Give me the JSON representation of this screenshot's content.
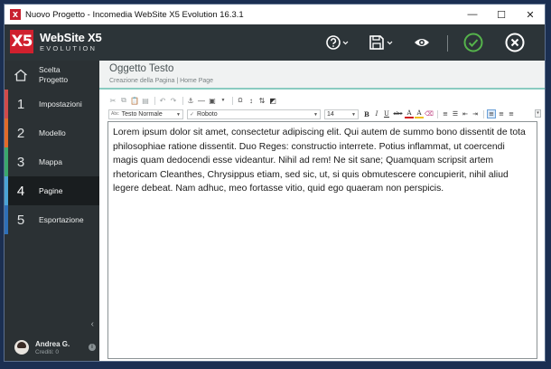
{
  "window": {
    "title": "Nuovo Progetto - Incomedia WebSite X5 Evolution 16.3.1",
    "controls": {
      "minimize": "—",
      "maximize": "☐",
      "close": "✕"
    }
  },
  "header": {
    "logo_main": "WebSite X5",
    "logo_sub": "EVOLUTION",
    "logo_mark": "X5",
    "actions": [
      "help-icon",
      "save-icon",
      "preview-icon",
      "confirm-icon",
      "close-icon"
    ],
    "colors": {
      "bar": "#2c3438",
      "accent": "#d0202e",
      "confirm": "#55b34b"
    }
  },
  "sidebar": {
    "home_label_1": "Scelta",
    "home_label_2": "Progetto",
    "items": [
      {
        "num": "1",
        "label": "Impostazioni",
        "color": "#d04a4a"
      },
      {
        "num": "2",
        "label": "Modello",
        "color": "#e06a2a"
      },
      {
        "num": "3",
        "label": "Mappa",
        "color": "#3aa76d"
      },
      {
        "num": "4",
        "label": "Pagine",
        "color": "#4aa3d6",
        "active": true
      },
      {
        "num": "5",
        "label": "Esportazione",
        "color": "#2e6fb8"
      }
    ],
    "collapse": "‹",
    "user_name": "Andrea G.",
    "user_credit": "Crediti: 0"
  },
  "panel": {
    "title": "Oggetto Testo",
    "breadcrumb": "Creazione della Pagina | Home Page"
  },
  "toolbar": {
    "style_prefix": "Abc",
    "style_value": "Testo Normale",
    "font_prefix": "✓",
    "font_value": "Roboto",
    "size_value": "14",
    "format_buttons": [
      "B",
      "I",
      "U",
      "abc",
      "A",
      "A",
      "⌫"
    ]
  },
  "editor": {
    "text": "Lorem ipsum dolor sit amet, consectetur adipiscing elit. Qui autem de summo bono dissentit de tota philosophiae ratione dissentit. Duo Reges: constructio interrete. Potius inflammat, ut coercendi magis quam dedocendi esse videantur. Nihil ad rem! Ne sit sane; Quamquam scripsit artem rhetoricam Cleanthes, Chrysippus etiam, sed sic, ut, si quis obmutescere concupierit, nihil aliud legere debeat. Nam adhuc, meo fortasse vitio, quid ego quaeram non perspicis."
  }
}
